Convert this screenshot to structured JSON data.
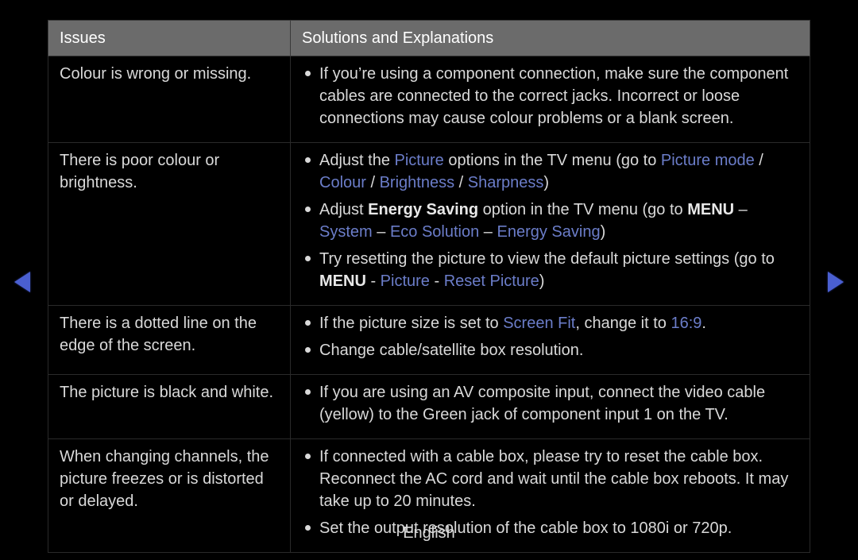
{
  "header": {
    "issues_label": "Issues",
    "solutions_label": "Solutions and Explanations"
  },
  "footer": {
    "language": "English"
  },
  "rows": [
    {
      "issue": "Colour is wrong or missing.",
      "bullets": [
        {
          "segments": [
            {
              "t": "If you’re using a component connection, make sure the component cables are connected to the correct jacks. Incorrect or loose connections may cause colour problems or a blank screen."
            }
          ]
        }
      ]
    },
    {
      "issue": "There is poor colour or brightness.",
      "bullets": [
        {
          "segments": [
            {
              "t": "Adjust the "
            },
            {
              "t": "Picture",
              "hl": true
            },
            {
              "t": " options in the TV menu (go to "
            },
            {
              "t": "Picture mode",
              "hl": true
            },
            {
              "t": " / "
            },
            {
              "t": "Colour",
              "hl": true
            },
            {
              "t": " / "
            },
            {
              "t": "Brightness",
              "hl": true
            },
            {
              "t": " / "
            },
            {
              "t": "Sharpness",
              "hl": true
            },
            {
              "t": ")"
            }
          ]
        },
        {
          "segments": [
            {
              "t": "Adjust "
            },
            {
              "t": "Energy Saving",
              "bold": true
            },
            {
              "t": " option in the TV menu (go to "
            },
            {
              "t": "MENU",
              "bold": true
            },
            {
              "t": " – "
            },
            {
              "t": "System",
              "hl": true
            },
            {
              "t": " – "
            },
            {
              "t": "Eco Solution",
              "hl": true
            },
            {
              "t": " – "
            },
            {
              "t": "Energy Saving",
              "hl": true
            },
            {
              "t": ")"
            }
          ]
        },
        {
          "segments": [
            {
              "t": "Try resetting the picture to view the default picture settings (go to "
            },
            {
              "t": "MENU",
              "bold": true
            },
            {
              "t": " - "
            },
            {
              "t": "Picture",
              "hl": true
            },
            {
              "t": " - "
            },
            {
              "t": "Reset Picture",
              "hl": true
            },
            {
              "t": ")"
            }
          ]
        }
      ]
    },
    {
      "issue": "There is a dotted line on the edge of the screen.",
      "bullets": [
        {
          "segments": [
            {
              "t": "If the picture size is set to "
            },
            {
              "t": "Screen Fit",
              "hl": true
            },
            {
              "t": ", change it to "
            },
            {
              "t": "16:9",
              "hl": true
            },
            {
              "t": "."
            }
          ]
        },
        {
          "segments": [
            {
              "t": "Change cable/satellite box resolution."
            }
          ]
        }
      ]
    },
    {
      "issue": "The picture is black and white.",
      "bullets": [
        {
          "segments": [
            {
              "t": "If you are using an AV composite input, connect the video cable (yellow) to the Green jack of component input 1 on the TV."
            }
          ]
        }
      ]
    },
    {
      "issue": "When changing channels, the picture freezes or is distorted or delayed.",
      "bullets": [
        {
          "segments": [
            {
              "t": "If connected with a cable box, please try to reset the cable box. Reconnect the AC cord and wait until the cable box reboots. It may take up to 20 minutes."
            }
          ]
        },
        {
          "segments": [
            {
              "t": "Set the output resolution of the cable box to 1080i or 720p."
            }
          ]
        }
      ]
    }
  ]
}
